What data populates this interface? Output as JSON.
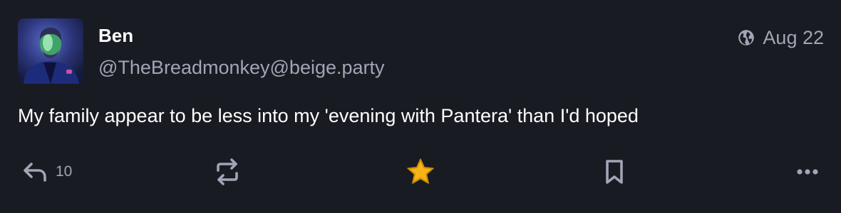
{
  "post": {
    "author": {
      "display_name": "Ben",
      "handle": "@TheBreadmonkey@beige.party",
      "avatar_icon": "avatar-photo"
    },
    "visibility_icon": "globe-icon",
    "timestamp": "Aug 22",
    "content": "My family appear to be less into my 'evening with Pantera' than I'd hoped",
    "actions": {
      "reply": {
        "icon": "reply-icon",
        "count": "10"
      },
      "boost": {
        "icon": "boost-icon"
      },
      "favourite": {
        "icon": "star-icon",
        "active": true
      },
      "bookmark": {
        "icon": "bookmark-icon"
      },
      "more": {
        "icon": "more-icon"
      }
    }
  },
  "colors": {
    "background": "#191b22",
    "primary_text": "#ffffff",
    "secondary_text": "#a3a4b5",
    "favourite_active": "#ca8f04"
  }
}
